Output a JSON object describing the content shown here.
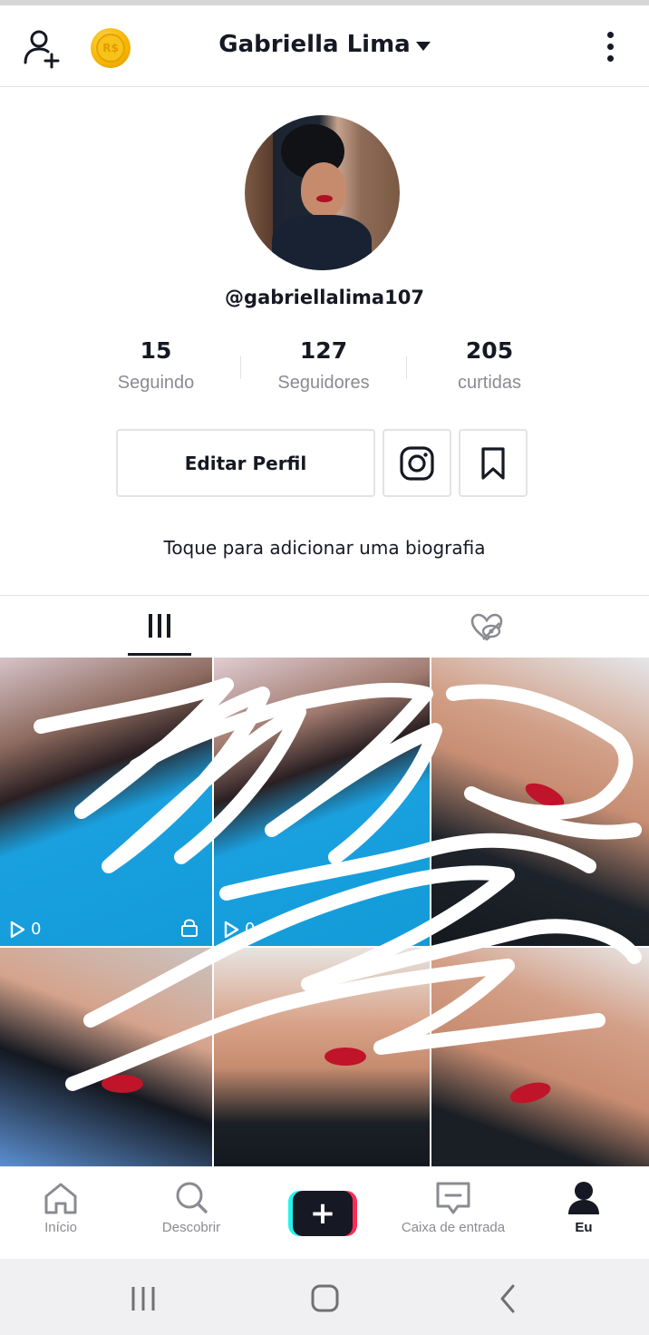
{
  "header": {
    "username_title": "Gabriella Lima",
    "coin_label": "R$"
  },
  "profile": {
    "handle": "@gabriellalima107",
    "stats": [
      {
        "value": "15",
        "label": "Seguindo"
      },
      {
        "value": "127",
        "label": "Seguidores"
      },
      {
        "value": "205",
        "label": "curtidas"
      }
    ],
    "edit_button_label": "Editar Perfil",
    "bio_prompt": "Toque para adicionar uma biografia"
  },
  "videos": [
    {
      "views": "0",
      "private": true
    },
    {
      "views": "0",
      "private": false
    },
    {
      "views": "",
      "private": false
    },
    {
      "views": "",
      "private": false
    },
    {
      "views": "",
      "private": false
    },
    {
      "views": "",
      "private": false
    }
  ],
  "bottom_nav": {
    "items": [
      {
        "label": "Início",
        "icon": "home-icon"
      },
      {
        "label": "Descobrir",
        "icon": "search-icon"
      },
      {
        "label": "",
        "icon": "plus-icon"
      },
      {
        "label": "Caixa de entrada",
        "icon": "inbox-icon"
      },
      {
        "label": "Eu",
        "icon": "profile-icon"
      }
    ],
    "active": "Eu",
    "create_symbol": "+"
  },
  "colors": {
    "text_primary": "#161823",
    "text_secondary": "#8a8b91",
    "border": "#e3e3e4",
    "tiktok_cyan": "#25f4ee",
    "tiktok_red": "#fe2c55"
  }
}
